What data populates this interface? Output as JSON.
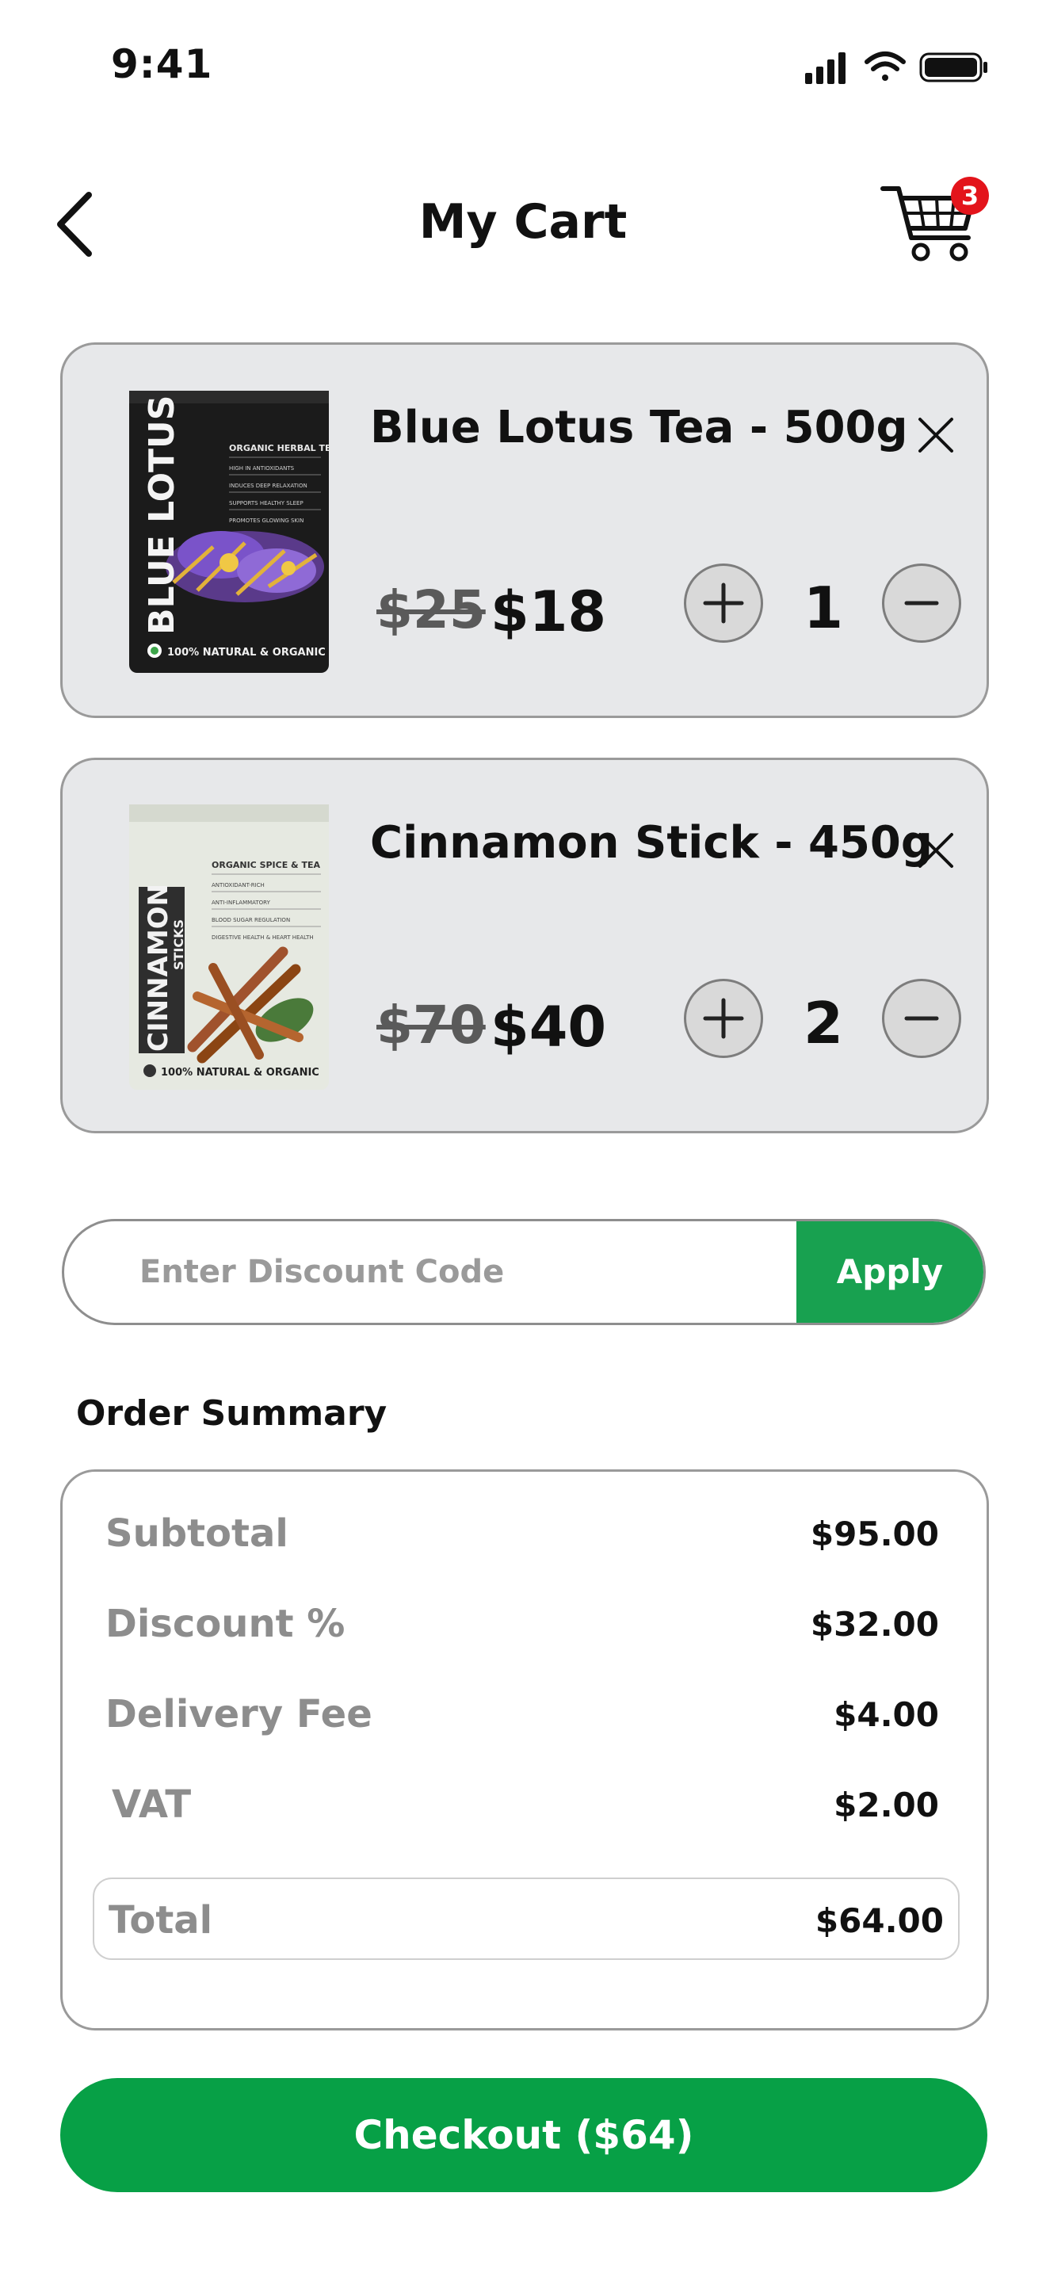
{
  "status_bar": {
    "time": "9:41",
    "icons": [
      "signal-icon",
      "wifi-icon",
      "battery-icon"
    ]
  },
  "header": {
    "title": "My Cart",
    "back_icon": "chevron-left-icon",
    "cart_icon": "cart-icon",
    "cart_badge": "3"
  },
  "cart_items": [
    {
      "name": "Blue Lotus Tea - 500g",
      "old_price": "$25",
      "price": "$18",
      "quantity": "1",
      "package": {
        "brand": "BLUE LOTUS",
        "subtitle": "ORGANIC HERBAL TEA",
        "claims": [
          "HIGH IN ANTIOXIDANTS",
          "INDUCES DEEP RELAXATION",
          "SUPPORTS HEALTHY SLEEP",
          "PROMOTES GLOWING SKIN"
        ],
        "footer": "100% NATURAL & ORGANIC",
        "color": "#1b1b1b",
        "accent": "#7a53c9"
      }
    },
    {
      "name": "Cinnamon Stick - 450g",
      "old_price": "$70",
      "price": "$40",
      "quantity": "2",
      "package": {
        "brand": "CINNAMON",
        "brand2": "STICKS",
        "subtitle": "ORGANIC SPICE & TEA",
        "claims": [
          "ANTIOXIDANT-RICH",
          "ANTI-INFLAMMATORY",
          "BLOOD SUGAR REGULATION",
          "DIGESTIVE HEALTH & HEART HEALTH"
        ],
        "footer": "100% NATURAL & ORGANIC",
        "color": "#e6e9e1",
        "accent": "#a0522d"
      }
    }
  ],
  "discount": {
    "placeholder": "Enter Discount Code",
    "value": "",
    "apply_label": "Apply"
  },
  "summary": {
    "title": "Order Summary",
    "rows": [
      {
        "label": "Subtotal",
        "value": "$95.00"
      },
      {
        "label": "Discount %",
        "value": "$32.00"
      },
      {
        "label": "Delivery Fee",
        "value": "$4.00"
      },
      {
        "label": "VAT",
        "value": "$2.00"
      }
    ],
    "total": {
      "label": "Total",
      "value": "$64.00"
    }
  },
  "checkout_label": "Checkout ($64)",
  "colors": {
    "primary_green": "#07a046",
    "apply_green": "#18a150",
    "badge_red": "#e3141b",
    "card_bg": "#e7e8ea"
  }
}
